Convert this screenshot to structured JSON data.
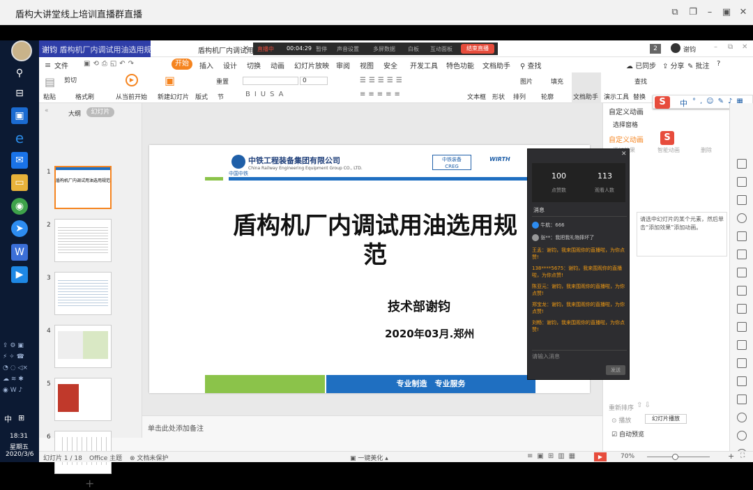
{
  "titlebar": {
    "title": "盾构大讲堂线上培训直播群直播"
  },
  "taskbar": {
    "time": "18:31",
    "weekday": "星期五",
    "date": "2020/3/6",
    "ime": "中"
  },
  "wps": {
    "file_tab": "盾构机厂内调试用油选用规范",
    "tab_num": "2",
    "user": "谢钧",
    "presenter_overlay": "谢钧",
    "live": {
      "status": "直播中",
      "timer": "00:04:29",
      "pause": "暂停",
      "audio": "声音设置",
      "mic": "多屏数据",
      "screen": "白板",
      "interact": "互动面板",
      "end": "结束直播"
    },
    "menu": {
      "file": "文件",
      "start": "开始",
      "insert": "插入",
      "design": "设计",
      "switch": "切换",
      "animation": "动画",
      "slideshow": "幻灯片放映",
      "review": "审阅",
      "view": "视图",
      "security": "安全",
      "devtools": "开发工具",
      "special": "特色功能",
      "assistant": "文档助手",
      "search": "查找",
      "sync": "已同步",
      "share": "分享",
      "comment": "批注"
    },
    "ribbon": {
      "paste": "粘贴",
      "cut": "剪切",
      "format": "格式刷",
      "from_current": "从当前开始",
      "new_slide": "新建幻灯片",
      "layout": "版式",
      "section": "节",
      "reset": "重置",
      "font_size": "0",
      "textbox": "文本框",
      "shape": "形状",
      "arrange": "排列",
      "outline": "轮廓",
      "doc_helper": "文档助手",
      "demo_tool": "演示工具",
      "replace": "替换",
      "select": "选择窗格",
      "find": "查找",
      "picture": "图片",
      "fill": "填充"
    }
  },
  "panel": {
    "tab_outline": "大纲",
    "tab_slides": "幻灯片",
    "slide_numbers": [
      "1",
      "2",
      "3",
      "4",
      "5",
      "6"
    ],
    "add": "+"
  },
  "slide": {
    "company_cn": "中铁工程装备集团有限公司",
    "company_en": "China Railway Engineering Equipment Group CO., LTD.",
    "logo_sub": "中国中铁",
    "brand1": "中铁装备",
    "brand1_sub": "CREG",
    "brand2": "WIRTH",
    "title": "盾构机厂内调试用油选用规范",
    "dept": "技术部谢钧",
    "date": "2020年03月.郑州",
    "slogan": "专业制造　专业服务"
  },
  "notes": {
    "placeholder": "单击此处添加备注"
  },
  "chat": {
    "stat1_value": "100",
    "stat1_label": "点赞数",
    "stat2_value": "113",
    "stat2_label": "观看人数",
    "section": "消息",
    "messages": [
      {
        "text": "牛航：666",
        "color": "#ccc"
      },
      {
        "text": "张**：我把我礼物摔坏了",
        "color": "#ccc"
      },
      {
        "text": "王孟：谢钧，我来围观你的直播啦，为你点赞!",
        "color": "#f39c12"
      },
      {
        "text": "138****5675：谢钧，我来围观你的直播啦，为你点赞!",
        "color": "#f39c12"
      },
      {
        "text": "陈亚元：谢钧，我来围观你的直播啦，为你点赞!",
        "color": "#f39c12"
      },
      {
        "text": "郑宝龙：谢钧，我来围观你的直播啦，为你点赞!",
        "color": "#f39c12"
      },
      {
        "text": "刘畅：谢钧，我来围观你的直播啦，为你点赞!",
        "color": "#f39c12"
      }
    ],
    "input_placeholder": "请输入消息",
    "send": "发送"
  },
  "right": {
    "title": "自定义动画",
    "select_pane": "选择窗格",
    "custom": "自定义动画",
    "add_effect": "添加效果",
    "smart_anim": "智能动画",
    "delete": "删除",
    "hint": "请选中幻灯片的某个元素，然后单击“添加效果”添加动画。",
    "reorder": "重新排序",
    "play": "播放",
    "slideshow": "幻灯片播放",
    "autopreview": "自动预览",
    "ime_brand": "S",
    "ime_lang": "中"
  },
  "status": {
    "slide": "幻灯片 1 / 18",
    "theme": "Office 主题",
    "protect": "文档未保护",
    "beautify": "一键美化",
    "zoom": "70%"
  }
}
